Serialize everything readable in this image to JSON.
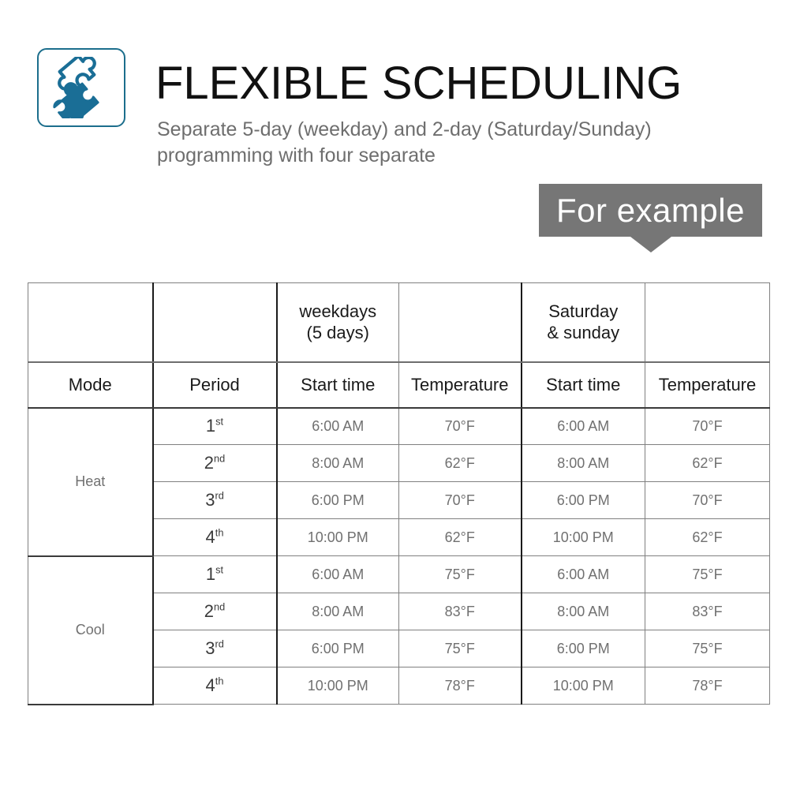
{
  "header": {
    "icon": "puzzle-pieces-icon",
    "icon_border_color": "#1c6e8c",
    "icon_fill_color": "#1a6e96",
    "title": "FLEXIBLE SCHEDULING",
    "subtitle": "Separate 5-day (weekday) and 2-day (Saturday/Sunday) programming with four separate"
  },
  "banner": {
    "label": "For example",
    "background_color": "#767676",
    "text_color": "#ffffff"
  },
  "table": {
    "group_headers": [
      "",
      "",
      "weekdays\n(5 days)",
      "",
      "Saturday\n& sunday",
      ""
    ],
    "group_header_weekdays_line1": "weekdays",
    "group_header_weekdays_line2": "(5 days)",
    "group_header_weekend_line1": "Saturday",
    "group_header_weekend_line2": "& sunday",
    "columns": [
      "Mode",
      "Period",
      "Start time",
      "Temperature",
      "Start time",
      "Temperature"
    ],
    "periods": [
      {
        "num": "1",
        "ord": "st"
      },
      {
        "num": "2",
        "ord": "nd"
      },
      {
        "num": "3",
        "ord": "rd"
      },
      {
        "num": "4",
        "ord": "th"
      }
    ],
    "groups": [
      {
        "mode": "Heat",
        "rows": [
          {
            "weekday_time": "6:00 AM",
            "weekday_temp": "70°F",
            "weekend_time": "6:00 AM",
            "weekend_temp": "70°F"
          },
          {
            "weekday_time": "8:00 AM",
            "weekday_temp": "62°F",
            "weekend_time": "8:00 AM",
            "weekend_temp": "62°F"
          },
          {
            "weekday_time": "6:00 PM",
            "weekday_temp": "70°F",
            "weekend_time": "6:00 PM",
            "weekend_temp": "70°F"
          },
          {
            "weekday_time": "10:00 PM",
            "weekday_temp": "62°F",
            "weekend_time": "10:00 PM",
            "weekend_temp": "62°F"
          }
        ]
      },
      {
        "mode": "Cool",
        "rows": [
          {
            "weekday_time": "6:00 AM",
            "weekday_temp": "75°F",
            "weekend_time": "6:00 AM",
            "weekend_temp": "75°F"
          },
          {
            "weekday_time": "8:00 AM",
            "weekday_temp": "83°F",
            "weekend_time": "8:00 AM",
            "weekend_temp": "83°F"
          },
          {
            "weekday_time": "6:00 PM",
            "weekday_temp": "75°F",
            "weekend_time": "6:00 PM",
            "weekend_temp": "75°F"
          },
          {
            "weekday_time": "10:00 PM",
            "weekday_temp": "78°F",
            "weekend_time": "10:00 PM",
            "weekend_temp": "78°F"
          }
        ]
      }
    ]
  }
}
